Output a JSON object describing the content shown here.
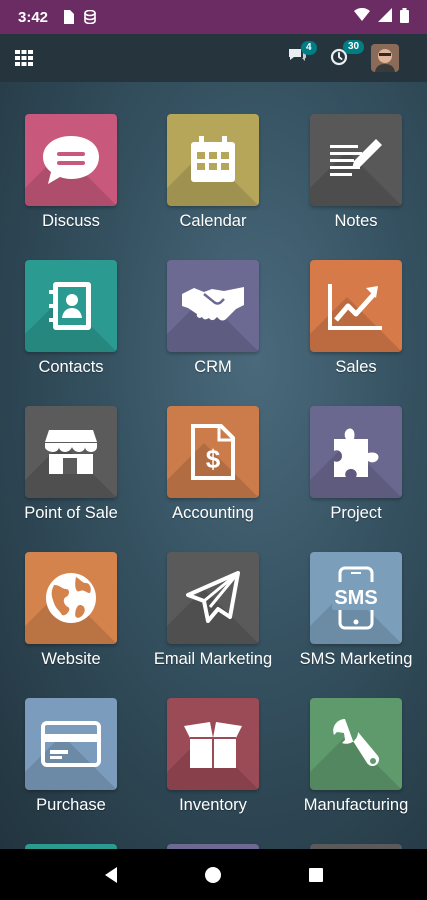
{
  "status": {
    "time": "3:42"
  },
  "topbar": {
    "messages_count": "4",
    "activities_count": "30"
  },
  "apps": [
    {
      "label": "Discuss",
      "color": "#c8597c",
      "icon": "chat-bubble-icon"
    },
    {
      "label": "Calendar",
      "color": "#b5a65a",
      "icon": "calendar-icon"
    },
    {
      "label": "Notes",
      "color": "#585858",
      "icon": "notes-icon"
    },
    {
      "label": "Contacts",
      "color": "#2b9a90",
      "icon": "contact-book-icon"
    },
    {
      "label": "CRM",
      "color": "#6c6a93",
      "icon": "handshake-icon"
    },
    {
      "label": "Sales",
      "color": "#d57a48",
      "icon": "trend-chart-icon"
    },
    {
      "label": "Point of Sale",
      "color": "#5b5b5b",
      "icon": "shop-icon"
    },
    {
      "label": "Accounting",
      "color": "#cb7c4a",
      "icon": "invoice-dollar-icon"
    },
    {
      "label": "Project",
      "color": "#6b6890",
      "icon": "puzzle-icon"
    },
    {
      "label": "Website",
      "color": "#d4834c",
      "icon": "globe-icon"
    },
    {
      "label": "Email Marketing",
      "color": "#5a5a5a",
      "icon": "paper-plane-icon"
    },
    {
      "label": "SMS Marketing",
      "color": "#7b9fbb",
      "icon": "sms-phone-icon"
    },
    {
      "label": "Purchase",
      "color": "#7b9cbc",
      "icon": "credit-card-icon"
    },
    {
      "label": "Inventory",
      "color": "#9b4b55",
      "icon": "open-box-icon"
    },
    {
      "label": "Manufacturing",
      "color": "#5f9a6d",
      "icon": "wrench-icon"
    }
  ]
}
